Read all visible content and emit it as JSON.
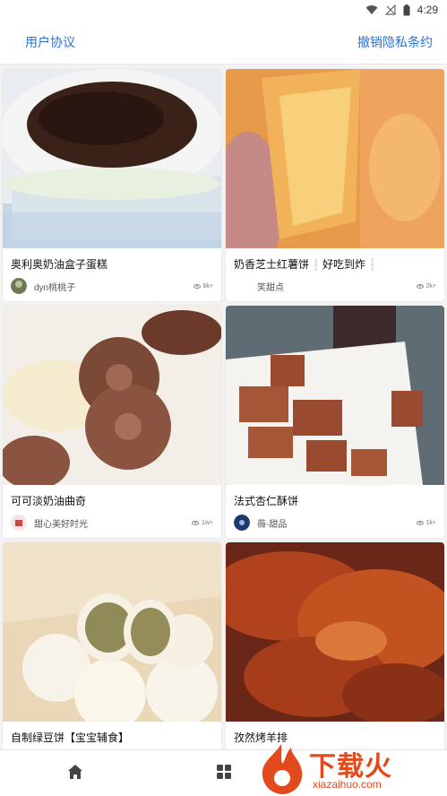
{
  "status_bar": {
    "time": "4:29",
    "icons": [
      "wifi-icon",
      "signal-off-icon",
      "battery-icon"
    ]
  },
  "top_bar": {
    "left_link": "用户协议",
    "right_link": "撤销隐私条约"
  },
  "cards": [
    {
      "title": "奥利奥奶油盒子蛋糕",
      "author": "dyn桃桃子",
      "views": "6k+"
    },
    {
      "title_parts": [
        "奶香芝士红薯饼",
        "❕",
        "好吃到炸",
        "❕"
      ],
      "author": "笑甜点",
      "views": "2k+"
    },
    {
      "title": "可可淡奶油曲奇",
      "author": "甜心美好时光",
      "views": "1w+"
    },
    {
      "title": "法式杏仁酥饼",
      "author": "薇-甜品",
      "views": "1k+"
    },
    {
      "title": "自制绿豆饼【宝宝辅食】",
      "author": "",
      "views": ""
    },
    {
      "title": "孜然烤羊排",
      "author": "",
      "views": ""
    }
  ],
  "bottom_nav": {
    "items": [
      "home-icon",
      "grid-icon"
    ]
  },
  "watermark": {
    "text": "下载火",
    "sub": "xiazaihuo.com"
  },
  "colors": {
    "accent": "#2f74d0",
    "watermark": "#e24a1c"
  }
}
